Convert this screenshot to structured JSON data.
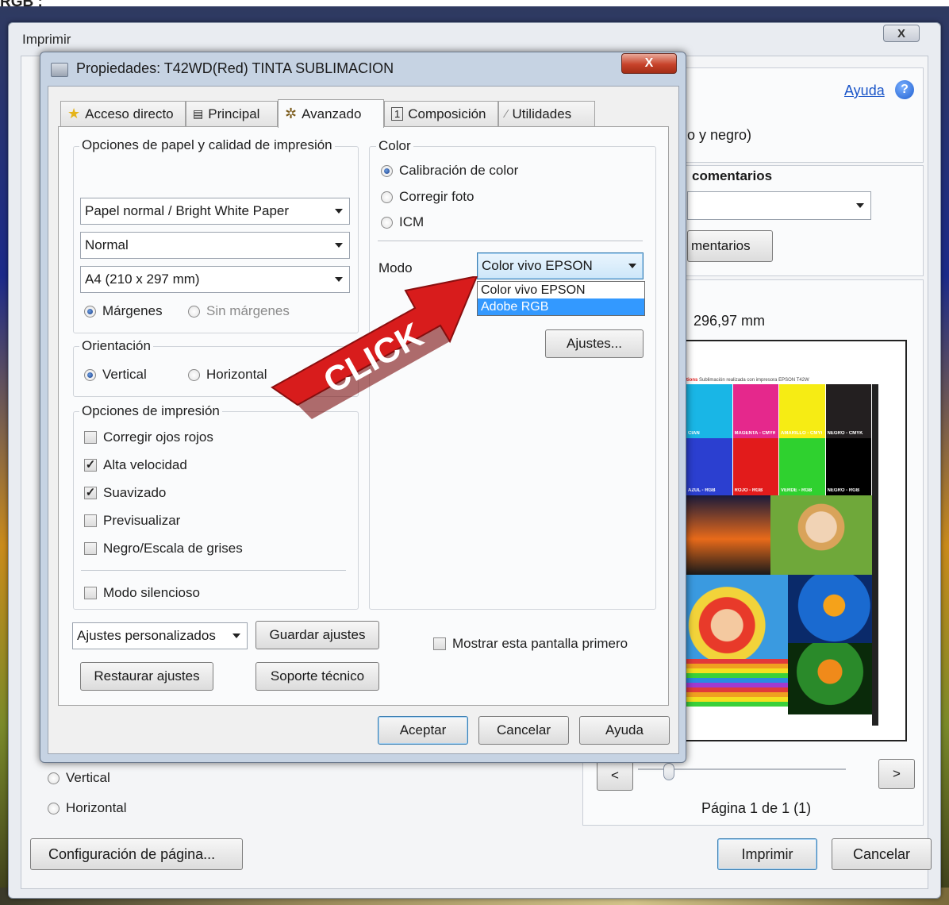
{
  "clipped_caption": "RGB :",
  "print_dialog": {
    "title": "Imprimir",
    "close_label": "X",
    "help_link": "Ayuda",
    "help_icon": "question-mark-icon",
    "color_text_partial": "o y negro)",
    "comments_title_partial": "comentarios",
    "comments_button_partial": "mentarios",
    "paper_size_partial": "296,97 mm",
    "orientation": {
      "vertical": "Vertical",
      "horizontal": "Horizontal",
      "selected": "Vertical"
    },
    "page_setup_button": "Configuración de página...",
    "print_button": "Imprimir",
    "cancel_button": "Cancelar",
    "prev_button": "<",
    "next_button": ">",
    "page_indicator": "Página 1 de 1 (1)",
    "preview": {
      "header_text": "Sublimación realizada con impresora EPSON T42W",
      "header_prefix": "tions",
      "color_labels_top": [
        "CIAN",
        "MAGENTA - CMYK",
        "AMARILLO - CMYK",
        "NEGRO - CMYK"
      ],
      "color_labels_bottom": [
        "AZUL - RGB",
        "ROJO - RGB",
        "VERDE - RGB",
        "NEGRO - RGB"
      ],
      "colors_top": [
        "#19b6e6",
        "#e5288c",
        "#f6ec14",
        "#231f20"
      ],
      "colors_bottom": [
        "#2b3fd0",
        "#e21b1b",
        "#2fd12f",
        "#000000"
      ]
    }
  },
  "properties_dialog": {
    "title": "Propiedades: T42WD(Red) TINTA SUBLIMACION",
    "close_label": "X",
    "tabs": [
      {
        "label": "Acceso directo",
        "icon": "star-icon"
      },
      {
        "label": "Principal",
        "icon": "printer-icon"
      },
      {
        "label": "Avanzado",
        "icon": "gear-icon"
      },
      {
        "label": "Composición",
        "icon": "page-icon"
      },
      {
        "label": "Utilidades",
        "icon": "wrench-icon"
      }
    ],
    "active_tab": "Avanzado",
    "paper_group": {
      "title": "Opciones de papel y calidad de impresión",
      "paper_type": "Papel normal / Bright White Paper",
      "quality": "Normal",
      "paper_size": "A4 (210 x 297 mm)",
      "margins": "Márgenes",
      "no_margins": "Sin márgenes"
    },
    "orientation_group": {
      "title": "Orientación",
      "vertical": "Vertical",
      "horizontal": "Horizontal"
    },
    "print_options_group": {
      "title": "Opciones de impresión",
      "options": [
        {
          "label": "Corregir ojos rojos",
          "checked": false
        },
        {
          "label": "Alta velocidad",
          "checked": true
        },
        {
          "label": "Suavizado",
          "checked": true
        },
        {
          "label": "Previsualizar",
          "checked": false
        },
        {
          "label": "Negro/Escala de grises",
          "checked": false
        }
      ],
      "silent_mode": {
        "label": "Modo silencioso",
        "checked": false
      }
    },
    "color_group": {
      "title": "Color",
      "options": [
        {
          "label": "Calibración de color",
          "selected": true
        },
        {
          "label": "Corregir foto",
          "selected": false
        },
        {
          "label": "ICM",
          "selected": false
        }
      ],
      "mode_label": "Modo",
      "mode_value": "Color vivo EPSON",
      "mode_options": [
        "Color vivo EPSON",
        "Adobe RGB"
      ],
      "mode_highlighted": "Adobe RGB",
      "settings_button": "Ajustes..."
    },
    "custom_settings_combo": "Ajustes personalizados",
    "save_settings_button": "Guardar ajustes",
    "restore_settings_button": "Restaurar ajustes",
    "tech_support_button": "Soporte técnico",
    "show_first_checkbox": "Mostrar esta pantalla primero",
    "ok_button": "Aceptar",
    "cancel_button": "Cancelar",
    "help_button": "Ayuda"
  },
  "annotation": {
    "arrow_text": "CLICK",
    "arrow_color": "#d81c1c"
  }
}
